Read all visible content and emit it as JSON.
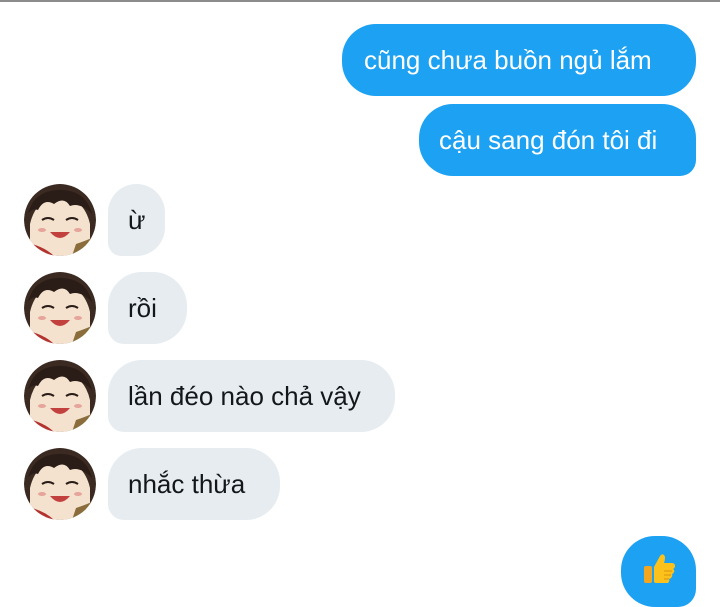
{
  "conversation": {
    "outgoing": [
      {
        "text": "cũng chưa buồn ngủ lắm"
      },
      {
        "text": "cậu sang đón tôi đi"
      }
    ],
    "incoming": [
      {
        "text": "ừ"
      },
      {
        "text": "rồi"
      },
      {
        "text": "lần đéo nào chả vậy"
      },
      {
        "text": "nhắc thừa"
      }
    ],
    "reaction": {
      "icon": "thumbs-up-icon"
    }
  },
  "colors": {
    "outgoing_bubble": "#1da1f2",
    "incoming_bubble": "#e6ecf0",
    "outgoing_text": "#ffffff",
    "incoming_text": "#14171a"
  }
}
